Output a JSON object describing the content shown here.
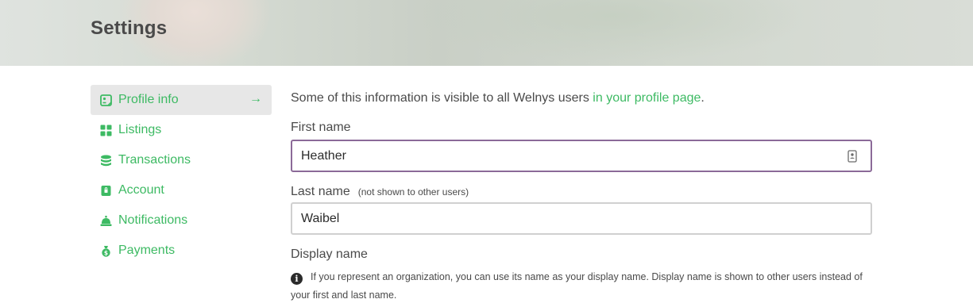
{
  "header": {
    "title": "Settings"
  },
  "sidebar": {
    "items": [
      {
        "label": "Profile info",
        "icon": "profile-card-icon",
        "active": true
      },
      {
        "label": "Listings",
        "icon": "grid-icon"
      },
      {
        "label": "Transactions",
        "icon": "database-icon"
      },
      {
        "label": "Account",
        "icon": "lock-icon"
      },
      {
        "label": "Notifications",
        "icon": "bell-icon"
      },
      {
        "label": "Payments",
        "icon": "money-bag-icon"
      }
    ],
    "active_arrow": "→"
  },
  "main": {
    "intro_text": "Some of this information is visible to all Welnys users ",
    "intro_link": "in your profile page",
    "intro_end": ".",
    "first_name": {
      "label": "First name",
      "value": "Heather"
    },
    "last_name": {
      "label": "Last name",
      "note": "(not shown to other users)",
      "value": "Waibel"
    },
    "display_name": {
      "label": "Display name",
      "info": "If you represent an organization, you can use its name as your display name. Display name is shown to other users instead of your first and last name."
    }
  },
  "colors": {
    "accent": "#3dba63",
    "focus_border": "#8b6a98",
    "text": "#4a4a4a"
  }
}
